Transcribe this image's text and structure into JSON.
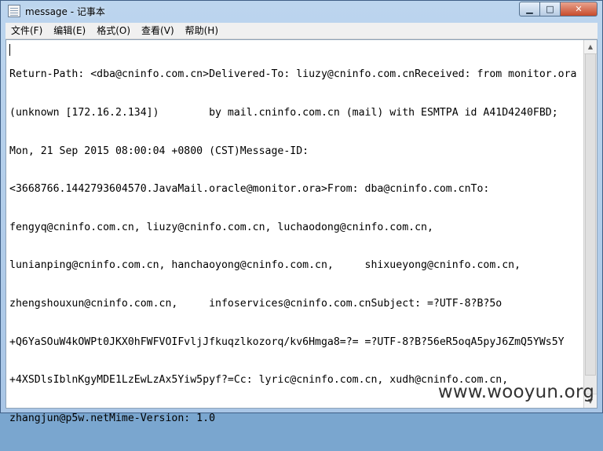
{
  "window": {
    "title": "message - 记事本",
    "controls": {
      "minimize": "▁",
      "maximize": "□",
      "close": "✕"
    }
  },
  "menu": {
    "items": [
      "文件(F)",
      "编辑(E)",
      "格式(O)",
      "查看(V)",
      "帮助(H)"
    ]
  },
  "editor": {
    "lines": [
      "Return-Path: <dba@cninfo.com.cn>Delivered-To: liuzy@cninfo.com.cnReceived: from monitor.ora",
      "(unknown [172.16.2.134])        by mail.cninfo.com.cn (mail) with ESMTPA id A41D4240FBD;",
      "Mon, 21 Sep 2015 08:00:04 +0800 (CST)Message-ID:",
      "<3668766.1442793604570.JavaMail.oracle@monitor.ora>From: dba@cninfo.com.cnTo:",
      "fengyq@cninfo.com.cn, liuzy@cninfo.com.cn, luchaodong@cninfo.com.cn,",
      "lunianping@cninfo.com.cn, hanchaoyong@cninfo.com.cn,     shixueyong@cninfo.com.cn,",
      "zhengshouxun@cninfo.com.cn,     infoservices@cninfo.com.cnSubject: =?UTF-8?B?5o",
      "+Q6YaSOuW4kOWPt0JKX0hFWFVOIFvljJfkuqzlkozorq/kv6Hmga8=?= =?UTF-8?B?56eR5oqA5pyJ6ZmQ5YWs5Y",
      "+4XSDlsIblnKgyMDE1LzEwLzAx5Yiw5pyf?=Cc: lyric@cninfo.com.cn, xudh@cninfo.com.cn,",
      "zhangjun@p5w.netMime-Version: 1.0"
    ]
  },
  "scrollbar": {
    "up": "▲",
    "down": "▼"
  },
  "watermark": "www.wooyun.org"
}
